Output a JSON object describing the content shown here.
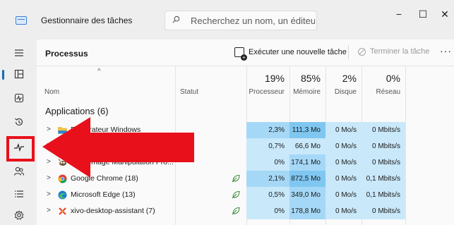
{
  "window": {
    "title": "Gestionnaire des tâches",
    "minimize_glyph": "−",
    "maximize_glyph": "☐",
    "close_glyph": "✕"
  },
  "search": {
    "placeholder": "Recherchez un nom, un éditeu..."
  },
  "nav": {
    "items": [
      {
        "icon": "hamburger-menu-icon"
      },
      {
        "icon": "processes-icon",
        "active": true
      },
      {
        "icon": "performance-icon"
      },
      {
        "icon": "app-history-icon"
      },
      {
        "icon": "startup-apps-icon",
        "highlighted": true
      },
      {
        "icon": "users-icon"
      },
      {
        "icon": "details-icon"
      },
      {
        "icon": "services-icon"
      }
    ]
  },
  "toolbar": {
    "page_title": "Processus",
    "run_new_task_label": "Exécuter une nouvelle tâche",
    "end_task_label": "Terminer la tâche",
    "more_glyph": "···"
  },
  "table": {
    "sort_glyph": "^",
    "headers": {
      "name": "Nom",
      "status": "Statut",
      "cpu_pct": "19%",
      "cpu_label": "Processeur",
      "mem_pct": "85%",
      "mem_label": "Mémoire",
      "disk_pct": "2%",
      "disk_label": "Disque",
      "net_pct": "0%",
      "net_label": "Réseau"
    },
    "group_label": "Applications (6)",
    "rows": [
      {
        "name": "Explorateur Windows",
        "efficiency": false,
        "cpu": "2,3%",
        "mem": "111,3 Mo",
        "disk": "0 Mo/s",
        "net": "0 Mbits/s",
        "icon": "folder-icon"
      },
      {
        "name": "",
        "efficiency": false,
        "cpu": "0,7%",
        "mem": "66,6 Mo",
        "disk": "0 Mo/s",
        "net": "0 Mbits/s",
        "icon": ""
      },
      {
        "name": "GNU Image Manipulation Pro...",
        "efficiency": false,
        "cpu": "0%",
        "mem": "174,1 Mo",
        "disk": "0 Mo/s",
        "net": "0 Mbits/s",
        "icon": "gimp-icon"
      },
      {
        "name": "Google Chrome (18)",
        "efficiency": true,
        "cpu": "2,1%",
        "mem": "872,5 Mo",
        "disk": "0 Mo/s",
        "net": "0,1 Mbits/s",
        "icon": "chrome-icon"
      },
      {
        "name": "Microsoft Edge (13)",
        "efficiency": true,
        "cpu": "0,5%",
        "mem": "349,0 Mo",
        "disk": "0 Mo/s",
        "net": "0,1 Mbits/s",
        "icon": "edge-icon"
      },
      {
        "name": "xivo-desktop-assistant (7)",
        "efficiency": true,
        "cpu": "0%",
        "mem": "178,8 Mo",
        "disk": "0 Mo/s",
        "net": "0 Mbits/s",
        "icon": "xivo-icon"
      }
    ]
  },
  "colors": {
    "accent": "#0f6cbd",
    "highlight_red": "#e8101a",
    "heat_light": "#c9e8fa",
    "heat_mid": "#a5d8f6",
    "heat_strong": "#7fc7f1",
    "efficiency_green": "#3a8a3a"
  }
}
